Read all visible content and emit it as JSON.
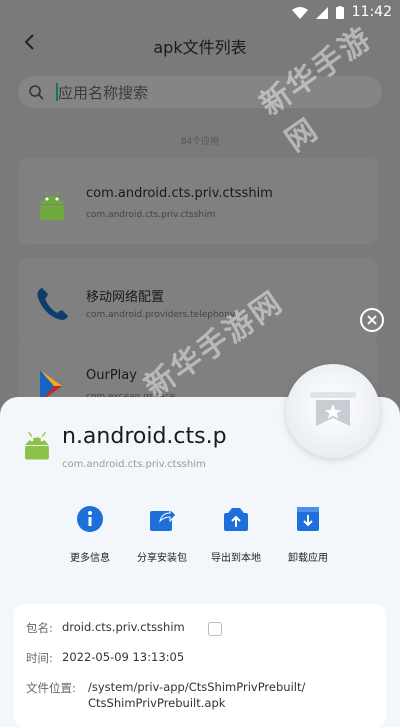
{
  "status_bar": {
    "time": "11:42"
  },
  "header": {
    "title": "apk文件列表"
  },
  "search": {
    "placeholder": "应用名称搜索"
  },
  "list": {
    "count_label": "84个应用",
    "items": [
      {
        "name": "com.android.cts.priv.ctsshim",
        "package": "com.android.cts.priv.ctsshim",
        "icon": "android-robot-icon"
      },
      {
        "name": "移动网络配置",
        "package": "com.android.providers.telephony",
        "icon": "phone-icon"
      },
      {
        "name": "OurPlay",
        "package": "com.excean.gspace",
        "icon": "play-store-icon"
      }
    ]
  },
  "watermark": {
    "text": "新华手游网"
  },
  "sheet": {
    "app_name": "n.android.cts.p",
    "package": "com.android.cts.priv.ctsshim",
    "actions": [
      {
        "label": "更多信息",
        "icon": "info-icon"
      },
      {
        "label": "分享安装包",
        "icon": "share-icon"
      },
      {
        "label": "导出到本地",
        "icon": "export-icon"
      },
      {
        "label": "卸载应用",
        "icon": "uninstall-icon"
      }
    ],
    "details": {
      "package_label": "包名:",
      "package_value": "droid.cts.priv.ctsshim",
      "time_label": "时间:",
      "time_value": "2022-05-09 13:13:05",
      "location_label": "文件位置:",
      "location_line1": "/system/priv-app/CtsShimPrivPrebuilt/",
      "location_line2": "CtsShimPrivPrebuilt.apk"
    }
  },
  "colors": {
    "accent": "#1e6fd9",
    "sheet_bg": "#f3f7fb",
    "android_green": "#8bc34a"
  }
}
